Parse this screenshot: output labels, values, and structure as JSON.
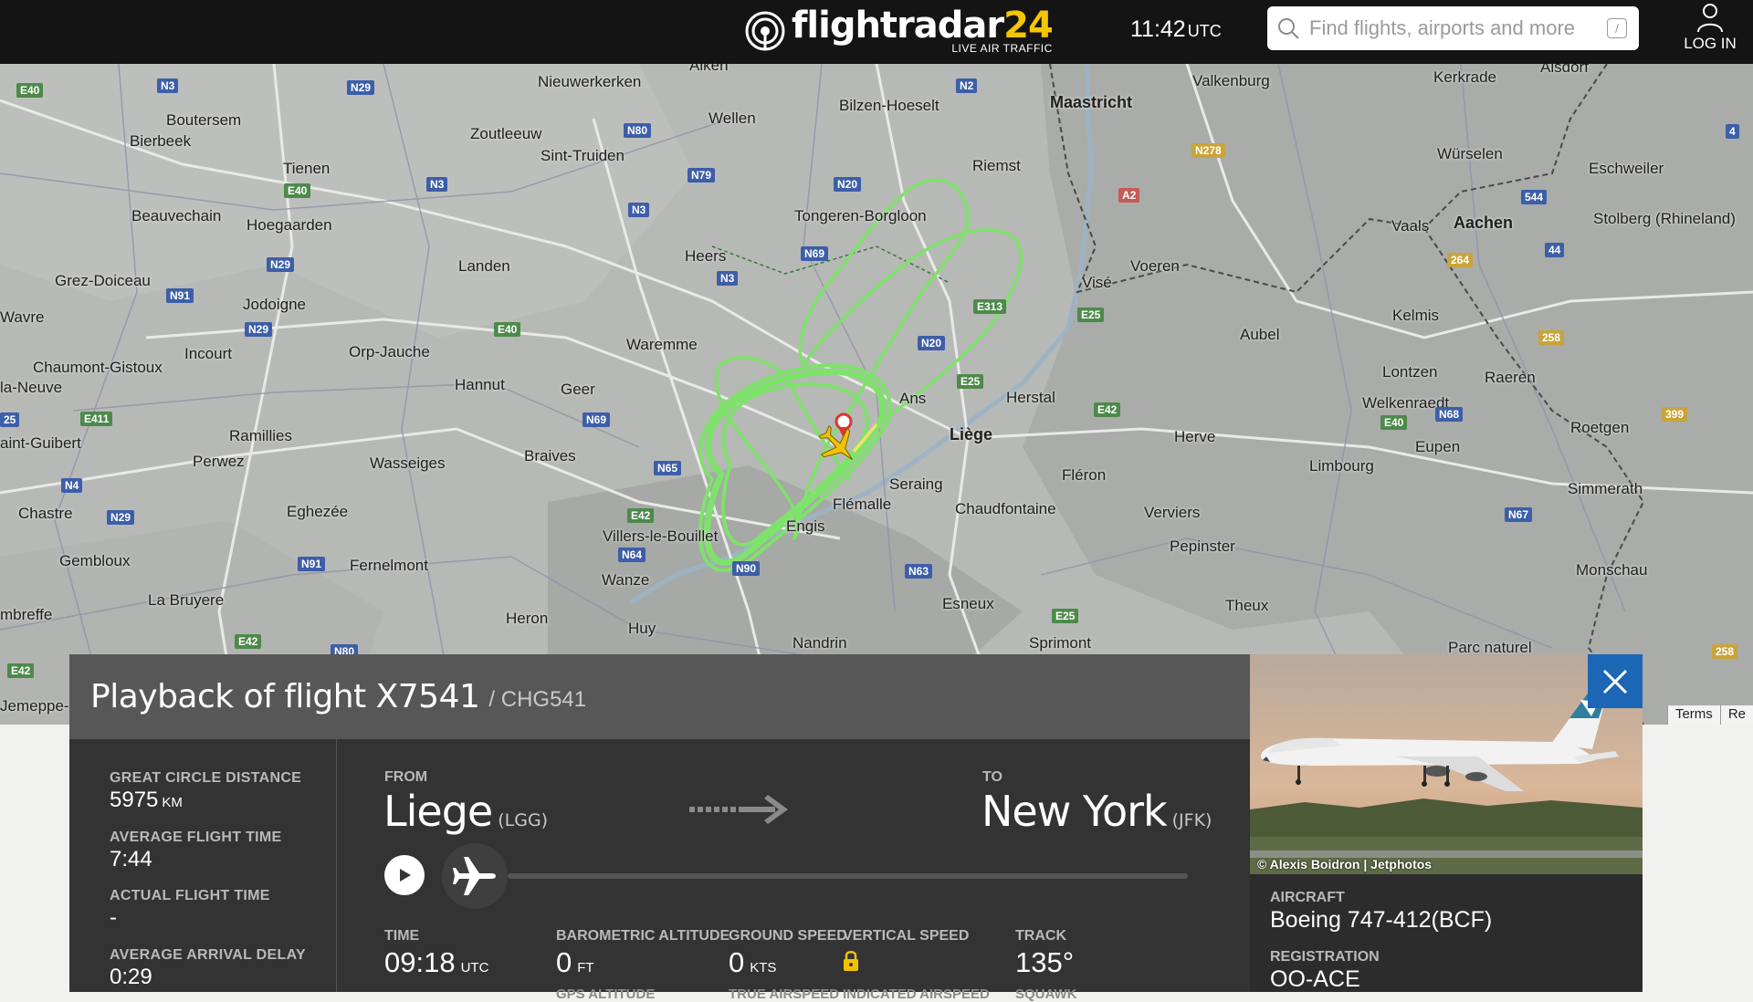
{
  "header": {
    "logo_name": "flightradar",
    "logo_number": "24",
    "logo_tagline": "LIVE AIR TRAFFIC",
    "clock_time": "11:42",
    "clock_zone": "UTC",
    "search_placeholder": "Find flights, airports and more",
    "search_shortcut": "/",
    "login_label": "LOG IN"
  },
  "map": {
    "towns": [
      "Nieuwerkerken",
      "Aiken",
      "Bilzen-Hoeselt",
      "Maastricht",
      "Valkenburg",
      "Kerkrade",
      "Alsdorf",
      "Boutersem",
      "Bierbeek",
      "Zoutleeuw",
      "Sint-Truiden",
      "Wellen",
      "Riemst",
      "Würselen",
      "Eschweiler",
      "Tienen",
      "Tongeren-Borgloon",
      "Aachen",
      "Stolberg (Rhineland)",
      "Beauvechain",
      "Hoegaarden",
      "Heers",
      "Vaals",
      "Voeren",
      "Grez-Doiceau",
      "Landen",
      "Visé",
      "Jodoigne",
      "Kelmis",
      "Wavre",
      "Waremme",
      "Aubel",
      "Orp-Jauche",
      "Incourt",
      "Chaumont-Gistoux",
      "Lontzen",
      "Raeren",
      "Hannut",
      "Geer",
      "Ans",
      "Herstal",
      "la-Neuve",
      "Welkenraedt",
      "Liège",
      "Ramillies",
      "Herve",
      "Roetgen",
      "aint-Guibert",
      "Perwez",
      "Wasseiges",
      "Braives",
      "Eupen",
      "Limbourg",
      "Seraing",
      "Fléron",
      "Simmerath",
      "Chastre",
      "Eghezée",
      "Flémalle",
      "Chaudfontaine",
      "Verviers",
      "Engis",
      "Villers-le-Bouillet",
      "Pepinster",
      "Gembloux",
      "Fernelmont",
      "Monschau",
      "Wanze",
      "La Bruyere",
      "Esneux",
      "Theux",
      "mbreffe",
      "Heron",
      "Huy",
      "Nandrin",
      "Sprimont",
      "Parc naturel",
      "Jemeppe-"
    ],
    "footer_links": [
      "Terms",
      "Re"
    ]
  },
  "playback": {
    "title": "Playback of flight X7541",
    "callsign": "/ CHG541",
    "stats": [
      {
        "label": "GREAT CIRCLE DISTANCE",
        "value": "5975",
        "unit": "KM"
      },
      {
        "label": "AVERAGE FLIGHT TIME",
        "value": "7:44",
        "unit": ""
      },
      {
        "label": "ACTUAL FLIGHT TIME",
        "value": "-",
        "unit": ""
      },
      {
        "label": "AVERAGE ARRIVAL DELAY",
        "value": "0:29",
        "unit": ""
      }
    ],
    "from_label": "FROM",
    "from_city": "Liege",
    "from_code": "(LGG)",
    "to_label": "TO",
    "to_city": "New York",
    "to_code": "(JFK)",
    "progress": 0.0,
    "telemetry": [
      {
        "label": "TIME",
        "value": "09:18",
        "unit": "UTC",
        "sub": ""
      },
      {
        "label": "BAROMETRIC ALTITUDE",
        "value": "0",
        "unit": "FT",
        "sub": "GPS ALTITUDE"
      },
      {
        "label": "GROUND SPEED",
        "value": "0",
        "unit": "KTS",
        "sub": "TRUE AIRSPEED"
      },
      {
        "label": "VERTICAL SPEED",
        "value": "",
        "unit": "",
        "sub": "INDICATED AIRSPEED"
      },
      {
        "label": "TRACK",
        "value": "135°",
        "unit": "",
        "sub": "SQUAWK"
      }
    ]
  },
  "aircraft": {
    "photo_credit": "© Alexis Boidron | Jetphotos",
    "aircraft_label": "AIRCRAFT",
    "aircraft_value": "Boeing 747-412(BCF)",
    "registration_label": "REGISTRATION",
    "registration_value": "OO-ACE"
  },
  "colors": {
    "topbar": "#141414",
    "track": "#7ee26b",
    "panel_header": "#575757",
    "panel_body": "#333333",
    "close_button": "#1c66b6",
    "aircraft_marker": "#f2c200"
  }
}
